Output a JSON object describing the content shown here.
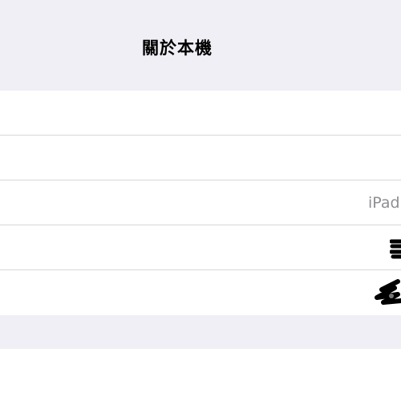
{
  "nav": {
    "title": "關於本機"
  },
  "rows": [
    {
      "label": "",
      "value": ""
    },
    {
      "label": "",
      "value": ""
    },
    {
      "label": "",
      "value": "iPad"
    },
    {
      "label": "",
      "value": ""
    },
    {
      "label": "",
      "value": ""
    }
  ],
  "colors": {
    "background": "#f0eff5",
    "cell": "#ffffff",
    "separator": "#d7d7dc",
    "secondary_text": "#8e8e93"
  }
}
